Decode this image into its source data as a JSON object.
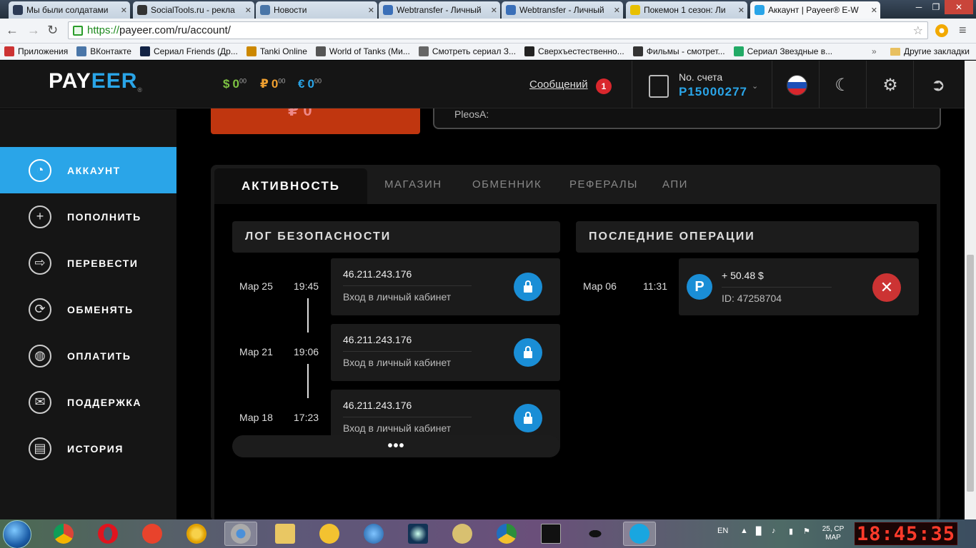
{
  "browser": {
    "tabs": [
      {
        "title": "Мы были солдатами",
        "active": false,
        "icon": "film-reel-icon"
      },
      {
        "title": "SocialTools.ru - рекла",
        "active": false,
        "icon": "socialtools-icon"
      },
      {
        "title": "Новости",
        "active": false,
        "icon": "vk-icon"
      },
      {
        "title": "Webtransfer - Личный",
        "active": false,
        "icon": "webtransfer-icon"
      },
      {
        "title": "Webtransfer - Личный",
        "active": false,
        "icon": "webtransfer-icon"
      },
      {
        "title": "Покемон 1 сезон: Ли",
        "active": false,
        "icon": "smiley-icon"
      },
      {
        "title": "Аккаунт | Payeer® E-W",
        "active": true,
        "icon": "payeer-icon"
      }
    ],
    "url_https": "https://",
    "url_rest": "payeer.com/ru/account/",
    "bookmarks": [
      {
        "label": "Приложения",
        "icon": "apps-grid-icon"
      },
      {
        "label": "ВКонтакте",
        "icon": "vk-icon"
      },
      {
        "label": "Сериал Friends (Др...",
        "icon": "friends-icon"
      },
      {
        "label": "Tanki Online",
        "icon": "tanki-icon"
      },
      {
        "label": "World of Tanks (Ми...",
        "icon": "wot-icon"
      },
      {
        "label": "Смотреть сериал З...",
        "icon": "list-icon"
      },
      {
        "label": "Сверхъестественно...",
        "icon": "bar-icon"
      },
      {
        "label": "Фильмы - смотрет...",
        "icon": "m-icon"
      },
      {
        "label": "Сериал Звездные в...",
        "icon": "f-icon"
      }
    ],
    "other_bookmarks": "Другие закладки",
    "bookmarks_overflow": "»"
  },
  "header": {
    "logo_pay": "PAY",
    "logo_eer": "EER",
    "logo_reg": "®",
    "balances": [
      {
        "symbol": "$",
        "int": "0",
        "dec": "00",
        "color": "#7dc242"
      },
      {
        "symbol": "₽",
        "int": "0",
        "dec": "00",
        "color": "#f0a030"
      },
      {
        "symbol": "€",
        "int": "0",
        "dec": "00",
        "color": "#2aa5e8"
      }
    ],
    "messages_label": "Сообщений",
    "messages_count": "1",
    "account_label": "No. счета",
    "account_number": "P15000277"
  },
  "sidebar": {
    "items": [
      {
        "label": "АККАУНТ",
        "icon": "speedometer-icon",
        "active": true
      },
      {
        "label": "ПОПОЛНИТЬ",
        "icon": "plus-circle-icon",
        "active": false
      },
      {
        "label": "ПЕРЕВЕСТИ",
        "icon": "arrow-right-icon",
        "active": false
      },
      {
        "label": "ОБМЕНЯТЬ",
        "icon": "exchange-icon",
        "active": false
      },
      {
        "label": "ОПЛАТИТЬ",
        "icon": "coins-icon",
        "active": false
      },
      {
        "label": "ПОДДЕРЖКА",
        "icon": "envelope-icon",
        "active": false
      },
      {
        "label": "ИСТОРИЯ",
        "icon": "book-icon",
        "active": false
      }
    ],
    "back_label": "←"
  },
  "top_section": {
    "red_box_text": "₽ 0",
    "info_label": "PleosA:"
  },
  "panel": {
    "tabs": [
      "АКТИВНОСТЬ",
      "МАГАЗИН",
      "ОБМЕННИК",
      "РЕФЕРАЛЫ",
      "АПИ"
    ],
    "security_log_title": "ЛОГ БЕЗОПАСНОСТИ",
    "last_ops_title": "ПОСЛЕДНИЕ ОПЕРАЦИИ",
    "security_log": [
      {
        "date": "Мар 25",
        "time": "19:45",
        "ip": "46.211.243.176",
        "desc": "Вход в личный кабинет"
      },
      {
        "date": "Мар 21",
        "time": "19:06",
        "ip": "46.211.243.176",
        "desc": "Вход в личный кабинет"
      },
      {
        "date": "Мар 18",
        "time": "17:23",
        "ip": "46.211.243.176",
        "desc": "Вход в личный кабинет"
      }
    ],
    "more_label": "•••",
    "operations": [
      {
        "date": "Мар 06",
        "time": "11:31",
        "amount": "+ 50.48 $",
        "id": "ID: 47258704",
        "icon_letter": "P"
      }
    ]
  },
  "taskbar": {
    "lang": "EN",
    "date_line1": "25, СР",
    "date_line2": "МАР",
    "clock": "18:45:35"
  }
}
